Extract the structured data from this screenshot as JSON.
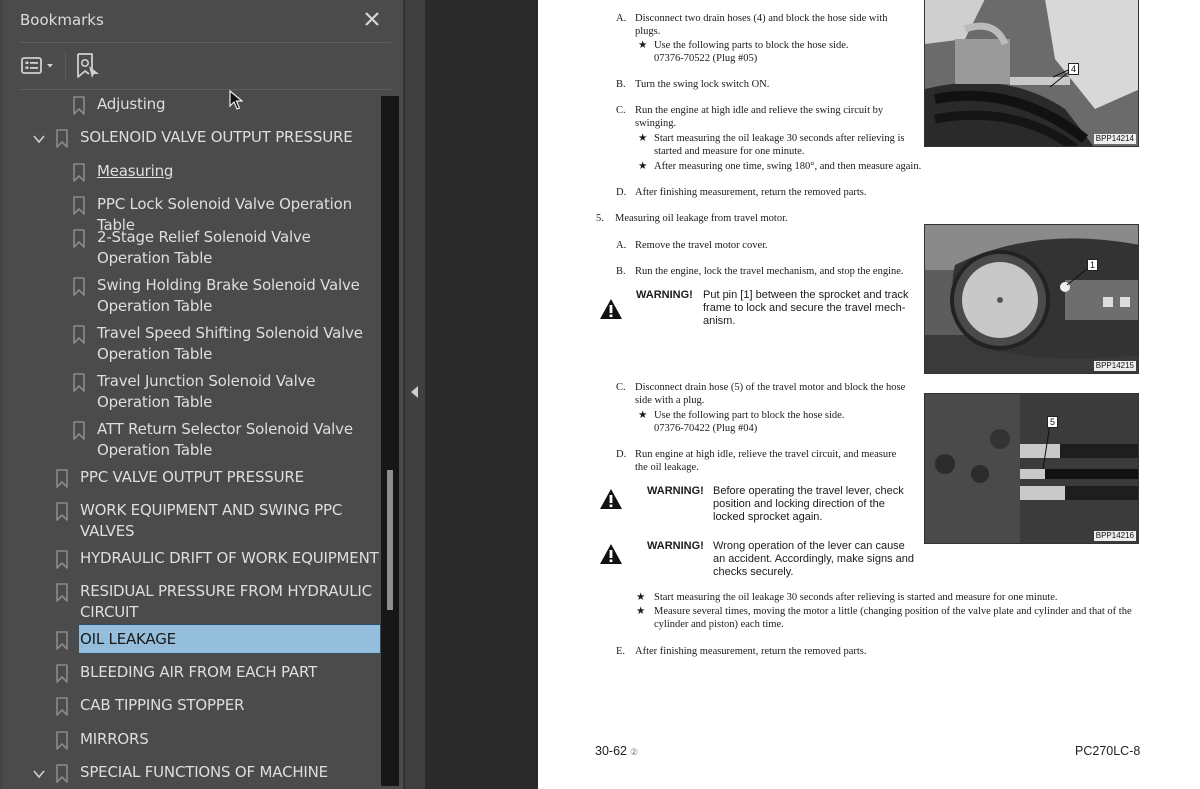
{
  "panel": {
    "title": "Bookmarks",
    "close_icon": "close-icon",
    "toolbar": {
      "options_icon": "list-options-icon",
      "find_icon": "find-current-bookmark-icon"
    }
  },
  "bookmarks": [
    {
      "label": "Adjusting",
      "level": 2
    },
    {
      "label": "SOLENOID VALVE OUTPUT PRESSURE",
      "level": 1,
      "expanded": true
    },
    {
      "label": "Measuring",
      "level": 2,
      "current": true
    },
    {
      "label": "PPC Lock Solenoid Valve Operation Table",
      "level": 2
    },
    {
      "label": "2-Stage Relief Solenoid Valve Operation Table",
      "level": 2
    },
    {
      "label": "Swing Holding Brake Solenoid Valve Operation Table",
      "level": 2
    },
    {
      "label": "Travel Speed Shifting Solenoid Valve Operation Table",
      "level": 2
    },
    {
      "label": "Travel Junction Solenoid Valve Operation Table",
      "level": 2
    },
    {
      "label": "ATT Return Selector Solenoid Valve Operation Table",
      "level": 2
    },
    {
      "label": "PPC VALVE OUTPUT PRESSURE",
      "level": 1
    },
    {
      "label": "WORK EQUIPMENT AND SWING PPC VALVES",
      "level": 1
    },
    {
      "label": "HYDRAULIC DRIFT OF WORK EQUIPMENT",
      "level": 1
    },
    {
      "label": "RESIDUAL PRESSURE FROM HYDRAULIC CIRCUIT",
      "level": 1
    },
    {
      "label": "OIL LEAKAGE",
      "level": 1,
      "selected": true
    },
    {
      "label": "BLEEDING AIR FROM EACH PART",
      "level": 1
    },
    {
      "label": "CAB TIPPING STOPPER",
      "level": 1
    },
    {
      "label": "MIRRORS",
      "level": 1
    },
    {
      "label": "SPECIAL FUNCTIONS OF MACHINE",
      "level": 1,
      "expanded": true
    }
  ],
  "document": {
    "lines": {
      "a1": "A.",
      "a1t": "Disconnect two drain hoses (4) and block the hose side with",
      "a1t2": "plugs.",
      "a1s": "Use the following parts to block the hose side.",
      "a1s2": "07376-70522 (Plug #05)",
      "b1": "B.",
      "b1t": "Turn the swing lock switch ON.",
      "c1": "C.",
      "c1t": "Run the engine at high idle and relieve the swing circuit by",
      "c1t2": "swinging.",
      "c1s": "Start measuring the oil leakage 30 seconds after relieving is",
      "c1s2": "started and measure for one minute.",
      "c1s3": "After measuring one time, swing 180°, and then measure again.",
      "d1": "D.",
      "d1t": "After finishing measurement, return the removed parts.",
      "n5": "5.",
      "n5t": "Measuring oil leakage from travel motor.",
      "a2": "A.",
      "a2t": "Remove the travel motor cover.",
      "b2": "B.",
      "b2t": "Run the engine, lock the travel mechanism, and stop the engine.",
      "w1k": "WARNING!",
      "w1t": "Put pin [1] between the sprocket and track",
      "w1t2": "frame to lock and secure the travel mech-",
      "w1t3": "anism.",
      "c2": "C.",
      "c2t": "Disconnect drain hose (5) of the travel motor and block the hose",
      "c2t2": "side with a plug.",
      "c2s": "Use the following part to block the hose side.",
      "c2s2": "07376-70422 (Plug #04)",
      "d2": "D.",
      "d2t": "Run engine at high idle, relieve the travel circuit, and measure",
      "d2t2": "the oil leakage.",
      "w2k": "WARNING!",
      "w2t": "Before operating the travel lever, check",
      "w2t2": "position and locking direction of the",
      "w2t3": "locked sprocket again.",
      "w3k": "WARNING!",
      "w3t": "Wrong operation of the lever can cause",
      "w3t2": "an accident. Accordingly, make signs and",
      "w3t3": "checks securely.",
      "s1": "Start measuring the oil leakage 30 seconds after relieving is started and measure for one minute.",
      "s2": "Measure several times, moving the motor a little (changing position of the valve plate and cylinder and that of the",
      "s2b": "cylinder and piston) each time.",
      "e2": "E.",
      "e2t": "After finishing measurement, return the removed parts.",
      "star": "★"
    },
    "figures": [
      {
        "id": "BPP14214",
        "callout": "4"
      },
      {
        "id": "BPP14215",
        "callout": "1"
      },
      {
        "id": "BPP14216",
        "callout": "5"
      }
    ],
    "footer": {
      "page": "30-62",
      "revision": "②",
      "model": "PC270LC-8"
    }
  }
}
